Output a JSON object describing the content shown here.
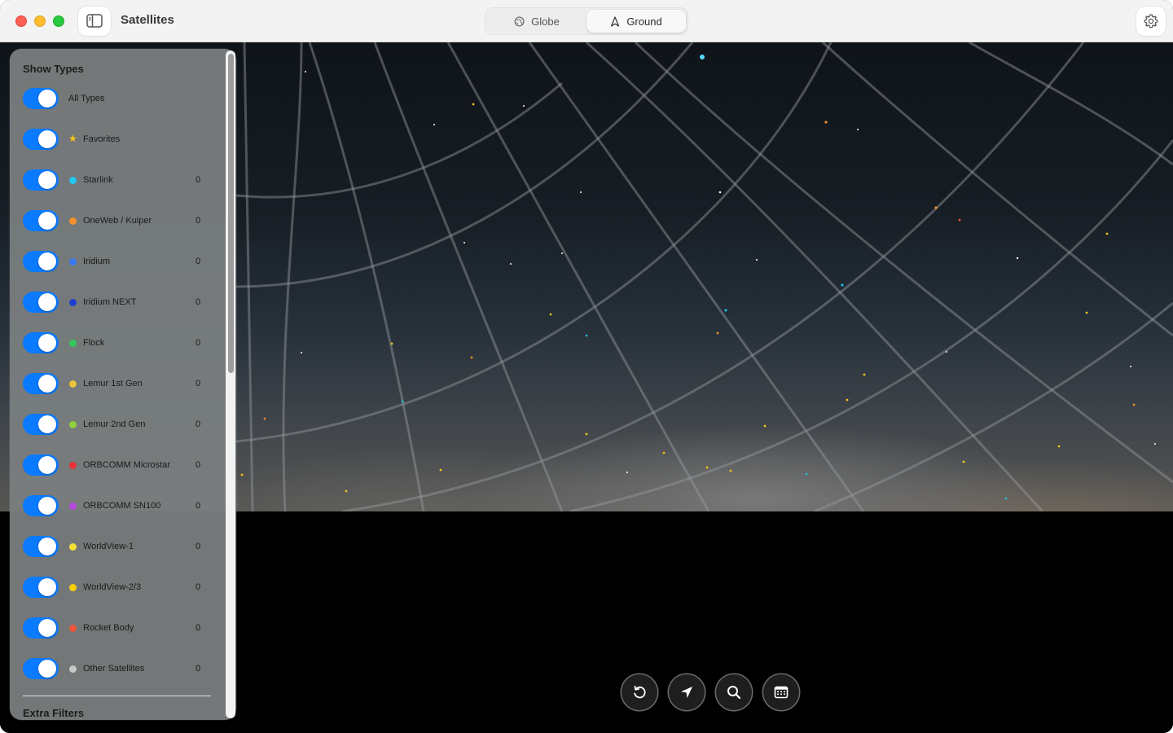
{
  "window": {
    "title": "Satellites"
  },
  "view_switcher": {
    "options": [
      {
        "label": "Globe",
        "icon": "globe-icon",
        "selected": false
      },
      {
        "label": "Ground",
        "icon": "compass-arrow-icon",
        "selected": true
      }
    ]
  },
  "panel": {
    "title": "Show Types",
    "types": [
      {
        "label": "All Types",
        "enabled": true,
        "marker": "none",
        "count": ""
      },
      {
        "label": "Favorites",
        "enabled": true,
        "marker": "star",
        "color": "#f5c518",
        "count": ""
      },
      {
        "label": "Starlink",
        "enabled": true,
        "marker": "dot",
        "color": "#1ec8f0",
        "count": "0"
      },
      {
        "label": "OneWeb / Kuiper",
        "enabled": true,
        "marker": "dot",
        "color": "#f5902a",
        "count": "0"
      },
      {
        "label": "Iridium",
        "enabled": true,
        "marker": "dot",
        "color": "#3a78f0",
        "count": "0"
      },
      {
        "label": "Iridium NEXT",
        "enabled": true,
        "marker": "dot",
        "color": "#1f3fd0",
        "count": "0"
      },
      {
        "label": "Flock",
        "enabled": true,
        "marker": "dot",
        "color": "#32c85a",
        "count": "0"
      },
      {
        "label": "Lemur 1st Gen",
        "enabled": true,
        "marker": "dot",
        "color": "#e8c23a",
        "count": "0"
      },
      {
        "label": "Lemur 2nd Gen",
        "enabled": true,
        "marker": "dot",
        "color": "#8fd13a",
        "count": "0"
      },
      {
        "label": "ORBCOMM Microstar",
        "enabled": true,
        "marker": "dot",
        "color": "#e8343a",
        "count": "0"
      },
      {
        "label": "ORBCOMM SN100",
        "enabled": true,
        "marker": "dot",
        "color": "#b84ae0",
        "count": "0"
      },
      {
        "label": "WorldView-1",
        "enabled": true,
        "marker": "dot",
        "color": "#f5e03a",
        "count": "0"
      },
      {
        "label": "WorldView-2/3",
        "enabled": true,
        "marker": "dot",
        "color": "#f5d00a",
        "count": "0"
      },
      {
        "label": "Rocket Body",
        "enabled": true,
        "marker": "dot",
        "color": "#f0563a",
        "count": "0"
      },
      {
        "label": "Other Satellites",
        "enabled": true,
        "marker": "dot",
        "color": "#c8c8c8",
        "count": "0"
      }
    ],
    "extra_title": "Extra Filters"
  },
  "controls": [
    {
      "name": "reset-view-button",
      "icon": "rotate-ccw-icon"
    },
    {
      "name": "locate-button",
      "icon": "location-arrow-icon"
    },
    {
      "name": "search-button",
      "icon": "magnifier-icon"
    },
    {
      "name": "calendar-button",
      "icon": "calendar-icon"
    }
  ],
  "colors": {
    "toggle_on": "#0a7aff",
    "titlebar": "#f3f3f3",
    "panel": "#7a7e80"
  }
}
